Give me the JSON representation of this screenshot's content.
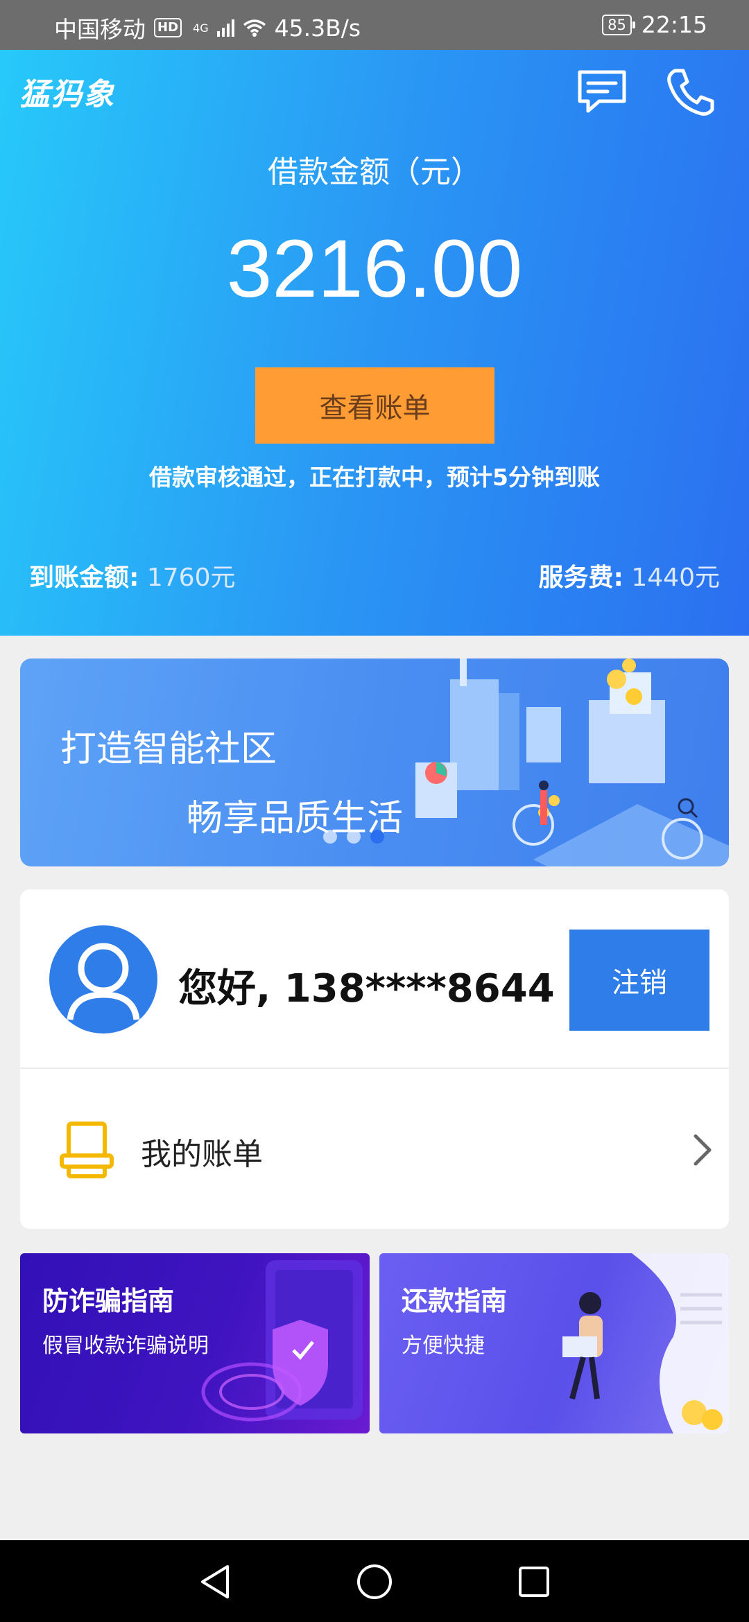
{
  "status_bar": {
    "carrier": "中国移动",
    "hd": "HD",
    "network": "4G",
    "speed": "45.3B/s",
    "battery": "85",
    "time": "22:15"
  },
  "header": {
    "app_name": "猛犸象",
    "message_icon": "message-icon",
    "phone_icon": "phone-icon"
  },
  "loan": {
    "amount_label": "借款金额（元）",
    "amount_value": "3216.00",
    "view_bill_label": "查看账单",
    "status_message": "借款审核通过，正在打款中，预计5分钟到账",
    "received_label": "到账金额:",
    "received_value": "1760元",
    "fee_label": "服务费:",
    "fee_value": "1440元"
  },
  "banner": {
    "line1": "打造智能社区",
    "line2": "畅享品质生活",
    "page_count": 3,
    "active_index": 2
  },
  "user": {
    "greeting": "您好, 138****8644",
    "logout_label": "注销"
  },
  "menu": {
    "my_bills_label": "我的账单",
    "my_bills_icon": "printer-icon"
  },
  "guides": [
    {
      "title": "防诈骗指南",
      "subtitle": "假冒收款诈骗说明"
    },
    {
      "title": "还款指南",
      "subtitle": "方便快捷"
    }
  ],
  "colors": {
    "hero_start": "#27c9fa",
    "hero_end": "#2b6ff0",
    "bill_button": "#ff9c33",
    "logout_button": "#2f7de9",
    "icon_yellow": "#f5b800"
  }
}
